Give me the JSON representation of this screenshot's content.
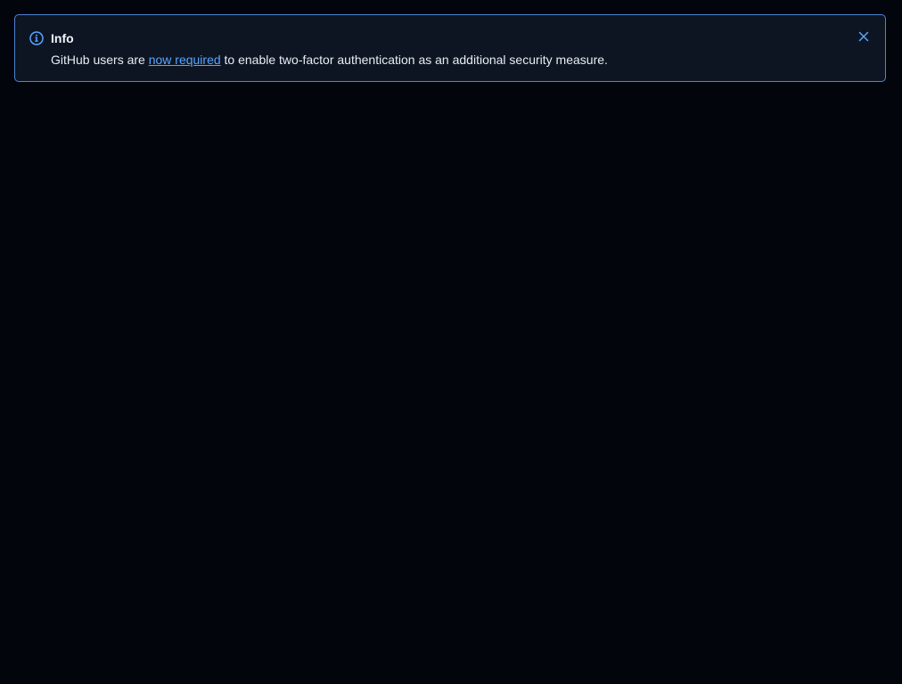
{
  "banner": {
    "title": "Info",
    "message_before": "GitHub users are ",
    "link_text": "now required",
    "message_after": " to enable two-factor authentication as an additional security measure.",
    "icon": "info-icon",
    "close_icon": "close-icon",
    "colors": {
      "background": "#0d1523",
      "border": "#4e84d6",
      "accent": "#58a6ff",
      "page_background": "#02050b"
    }
  }
}
